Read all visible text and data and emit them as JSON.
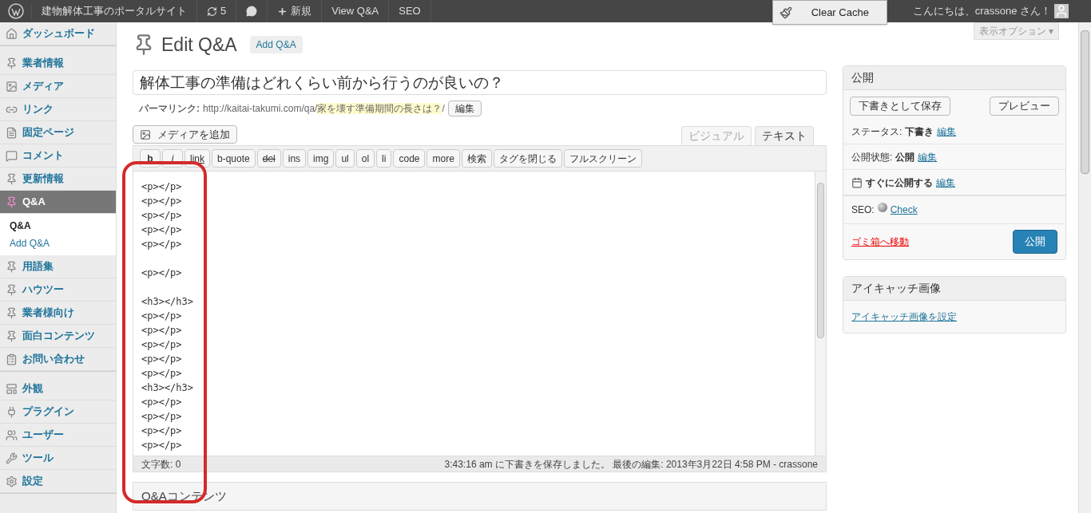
{
  "admin_bar": {
    "site": "建物解体工事のポータルサイト",
    "updates": "5",
    "new": "新規",
    "links": [
      "View Q&A",
      "SEO"
    ],
    "clear_cache": "Clear Cache",
    "greeting": "こんにちは、crassone さん！"
  },
  "screen_options": "表示オプション ▾",
  "sidebar": {
    "groups": [
      {
        "items": [
          {
            "label": "ダッシュボード",
            "selected": false
          }
        ]
      },
      {
        "items": [
          {
            "label": "業者情報",
            "selected": false
          },
          {
            "label": "メディア",
            "selected": false
          },
          {
            "label": "リンク",
            "selected": false
          },
          {
            "label": "固定ページ",
            "selected": false
          },
          {
            "label": "コメント",
            "selected": false
          },
          {
            "label": "更新情報",
            "selected": false
          },
          {
            "label": "Q&A",
            "selected": true,
            "children": [
              {
                "label": "Q&A",
                "selected": true
              },
              {
                "label": "Add Q&A",
                "selected": false
              }
            ]
          },
          {
            "label": "用語集",
            "selected": false
          },
          {
            "label": "ハウツー",
            "selected": false
          },
          {
            "label": "業者様向け",
            "selected": false
          },
          {
            "label": "面白コンテンツ",
            "selected": false
          },
          {
            "label": "お問い合わせ",
            "selected": false
          }
        ]
      },
      {
        "items": [
          {
            "label": "外観",
            "selected": false
          },
          {
            "label": "プラグイン",
            "selected": false
          },
          {
            "label": "ユーザー",
            "selected": false
          },
          {
            "label": "ツール",
            "selected": false
          },
          {
            "label": "設定",
            "selected": false
          }
        ]
      }
    ]
  },
  "page": {
    "title": "Edit Q&A",
    "add_button": "Add Q&A"
  },
  "post_title": "解体工事の準備はどれくらい前から行うのが良いの？",
  "permalink": {
    "label": "パーマリンク:",
    "base": "http://kaitai-takumi.com/qa/",
    "slug": "家を壊す準備期間の長さは？",
    "tail": "/",
    "edit": "編集"
  },
  "add_media": "メディアを追加",
  "editor_tabs": [
    {
      "label": "ビジュアル",
      "selected": false
    },
    {
      "label": "テキスト",
      "selected": true
    }
  ],
  "quicktags": [
    {
      "label": "b",
      "kind": "bold"
    },
    {
      "label": "i",
      "kind": "italic"
    },
    {
      "label": "link",
      "kind": "link"
    },
    {
      "label": "b-quote",
      "kind": "plain"
    },
    {
      "label": "del",
      "kind": "strike"
    },
    {
      "label": "ins",
      "kind": "plain"
    },
    {
      "label": "img",
      "kind": "plain"
    },
    {
      "label": "ul",
      "kind": "plain"
    },
    {
      "label": "ol",
      "kind": "plain"
    },
    {
      "label": "li",
      "kind": "plain"
    },
    {
      "label": "code",
      "kind": "plain"
    },
    {
      "label": "more",
      "kind": "plain"
    },
    {
      "label": "検索",
      "kind": "plain"
    },
    {
      "label": "タグを閉じる",
      "kind": "plain"
    },
    {
      "label": "フルスクリーン",
      "kind": "plain"
    }
  ],
  "editor_paragraphs": [
    {
      "lines": [
        "<p></p>",
        "<p></p>",
        "<p></p>",
        "<p></p>",
        "<p></p>"
      ]
    },
    {
      "lines": [
        "<p></p>"
      ]
    },
    {
      "lines": [
        "<h3></h3>",
        "<p></p>",
        "<p></p>",
        "<p></p>",
        "<p></p>",
        "<p></p>",
        "<h3></h3>",
        "<p></p>",
        "<p></p>",
        "<p></p>",
        "<p></p>"
      ]
    }
  ],
  "status": {
    "word_count": "文字数: 0",
    "saved": "3:43:16 am に下書きを保存しました。 最後の編集: 2013年3月22日 4:58 PM - crassone"
  },
  "next_box": "Q&Aコンテンツ",
  "publish_box": {
    "title": "公開",
    "save_draft": "下書きとして保存",
    "preview": "プレビュー",
    "rows": [
      {
        "label": "ステータス:",
        "value": "下書き",
        "edit": "編集",
        "kind": "status"
      },
      {
        "label": "公開状態:",
        "value": "公開",
        "edit": "編集",
        "kind": "visibility"
      },
      {
        "value": "すぐに公開する",
        "edit": "編集",
        "kind": "schedule"
      }
    ],
    "seo": {
      "label": "SEO:",
      "link": "Check"
    },
    "trash": "ゴミ箱へ移動",
    "publish": "公開"
  },
  "featured_box": {
    "title": "アイキャッチ画像",
    "link": "アイキャッチ画像を設定"
  }
}
